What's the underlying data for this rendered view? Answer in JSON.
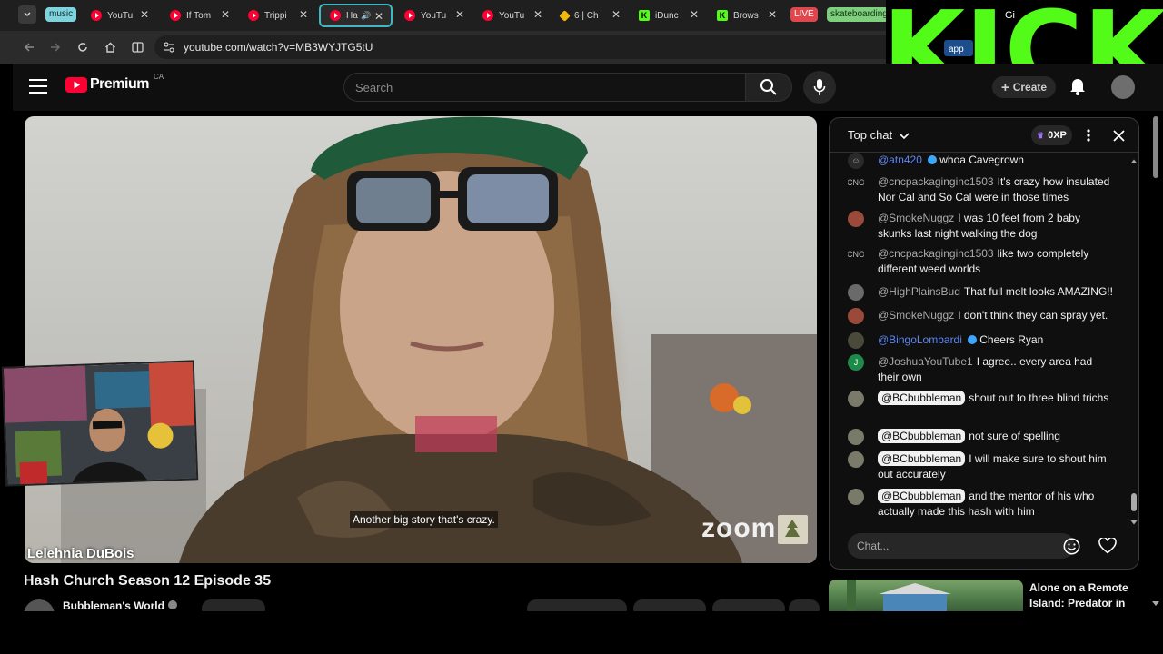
{
  "browser": {
    "tabs": [
      {
        "label": "YouTu",
        "favicon": "youtube-icon"
      },
      {
        "label": "If Tom",
        "favicon": "youtube-icon"
      },
      {
        "label": "Trippi",
        "favicon": "youtube-icon"
      },
      {
        "label": "Ha",
        "favicon": "youtube-icon",
        "active": true,
        "audio": true
      },
      {
        "label": "YouTu",
        "favicon": "youtube-icon"
      },
      {
        "label": "YouTu",
        "favicon": "youtube-icon"
      },
      {
        "label": "6 | Ch",
        "favicon": "binance-icon"
      },
      {
        "label": "iDunc",
        "favicon": "kick-icon"
      },
      {
        "label": "Brows",
        "favicon": "kick-icon"
      }
    ],
    "groups": {
      "music": "music",
      "live": "LIVE",
      "skateboarding": "skateboarding"
    },
    "address": "youtube.com/watch?v=MB3WYJTG5tU",
    "close_symbol": "✕",
    "overlay_text": "KICK",
    "partial_button": "app",
    "partial_tab": "Gi",
    "colors": {
      "tab_active_border": "#3fb7c4",
      "kick_green": "#53fc18",
      "youtube_red": "#ff0033"
    }
  },
  "youtube": {
    "logo_text": "Premium",
    "region": "CA",
    "search_placeholder": "Search",
    "create_label": "Create",
    "video": {
      "subtitle": "Another big story that's crazy.",
      "participant_name": "Lelehnia DuBois",
      "watermark": "zoom"
    },
    "title": "Hash Church Season 12 Episode 35",
    "channel": "Bubbleman's World"
  },
  "chat": {
    "header": "Top chat",
    "xp": "0XP",
    "input_placeholder": "Chat...",
    "messages": [
      {
        "author": "@atn420",
        "text": "whoa Cavegrown",
        "verified": true,
        "style": "mod"
      },
      {
        "author": "@cncpackaginginc1503",
        "text": "It's crazy how insulated Nor Cal and So Cal were in those times",
        "avatar": "CNO"
      },
      {
        "author": "@SmokeNuggz",
        "text": "I was 10 feet from 2 baby skunks last night walking the dog"
      },
      {
        "author": "@cncpackaginginc1503",
        "text": "like two completely different weed worlds",
        "avatar": "CNO"
      },
      {
        "author": "@HighPlainsBud",
        "text": "That full melt looks AMAZING!!"
      },
      {
        "author": "@SmokeNuggz",
        "text": "I don't think they can spray yet."
      },
      {
        "author": "@BingoLombardi",
        "text": "Cheers Ryan",
        "verified": true,
        "style": "mod"
      },
      {
        "author": "@JoshuaYouTube1",
        "text": "I agree.. every area had their own",
        "avatar": "J"
      },
      {
        "author": "@BCbubbleman",
        "text": "shout out to three blind trichs",
        "style": "owner"
      },
      {
        "author": "@BCbubbleman",
        "text": "not sure of spelling",
        "style": "owner"
      },
      {
        "author": "@BCbubbleman",
        "text": "I will make sure to shout him out accurately",
        "style": "owner"
      },
      {
        "author": "@BCbubbleman",
        "text": "and the mentor of his who actually made this hash with him",
        "style": "owner"
      }
    ]
  },
  "recommendation": {
    "title": "Alone on a Remote Island: Predator in the"
  }
}
